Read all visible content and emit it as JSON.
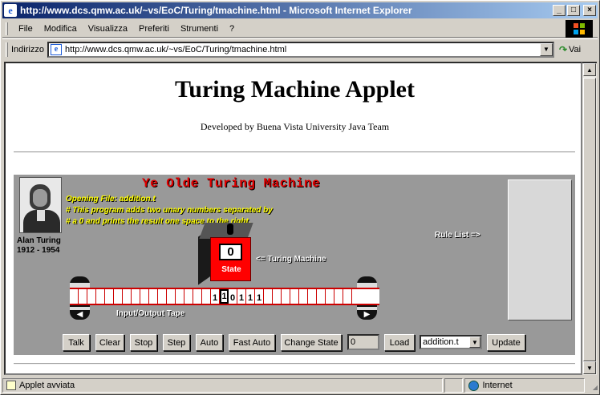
{
  "window": {
    "title": "http://www.dcs.qmw.ac.uk/~vs/EoC/Turing/tmachine.html - Microsoft Internet Explorer",
    "minimize": "_",
    "maximize": "□",
    "close": "×"
  },
  "menu": [
    "File",
    "Modifica",
    "Visualizza",
    "Preferiti",
    "Strumenti",
    "?"
  ],
  "address": {
    "label": "Indirizzo",
    "url": "http://www.dcs.qmw.ac.uk/~vs/EoC/Turing/tmachine.html",
    "go": "Vai"
  },
  "page": {
    "title": "Turing Machine Applet",
    "subtitle": "Developed by Buena Vista University Java Team"
  },
  "applet": {
    "title": "Ye Olde Turing Machine",
    "messages": [
      "Opening File: addition.t",
      "# This program adds two unary numbers separated by",
      "# a 0 and prints the result one space to the right."
    ],
    "photo_caption": [
      "Alan Turing",
      "1912 - 1954"
    ],
    "rule_list_label": "Rule List =>",
    "machine_label": "<= Turing Machine",
    "state_value": "0",
    "state_label": "State",
    "io_label": "Input/Output Tape",
    "tape": {
      "cells_before": 16,
      "head_cell": "1",
      "symbols_before_head": [
        "1"
      ],
      "symbols_after_head": [
        "0",
        "1",
        "1",
        "1"
      ],
      "cells_after": 11
    },
    "buttons": {
      "talk": "Talk",
      "clear": "Clear",
      "stop": "Stop",
      "step": "Step",
      "auto": "Auto",
      "fast_auto": "Fast Auto",
      "change_state": "Change State",
      "state_input": "0",
      "load": "Load",
      "file_select": "addition.t",
      "update": "Update"
    }
  },
  "status": {
    "text": "Applet avviata",
    "zone": "Internet"
  },
  "colors": {
    "titlebar": "#0a246a",
    "applet_bg": "#999999",
    "applet_title": "#e00000",
    "message_text": "#ffff00",
    "machine": "#ff0000"
  }
}
